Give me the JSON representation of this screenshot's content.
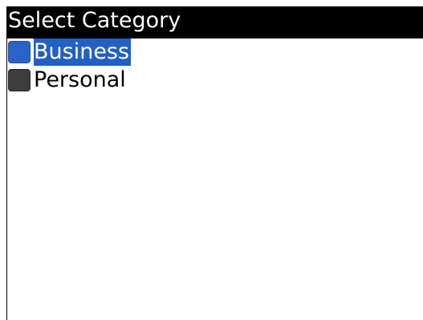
{
  "title": "Select Category",
  "categories": [
    {
      "label": "Business",
      "color": "#2b62c6",
      "selected": true
    },
    {
      "label": "Personal",
      "color": "#3c3c3c",
      "selected": false
    }
  ],
  "colors": {
    "title_bar": "#000000",
    "selection_highlight": "#2260c2"
  }
}
